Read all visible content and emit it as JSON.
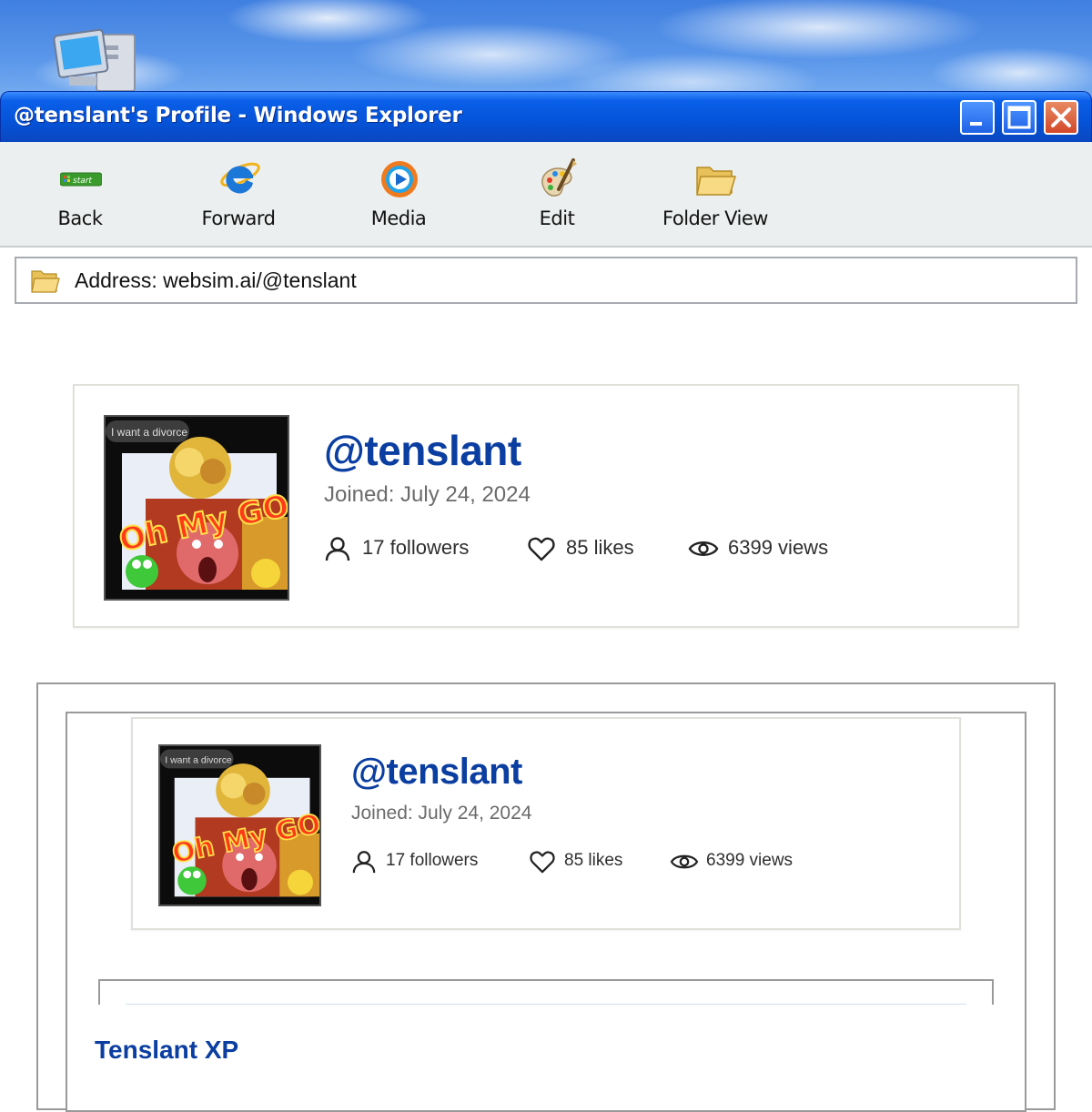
{
  "window": {
    "title": "@tenslant's Profile - Windows Explorer",
    "controls": {
      "minimize": "minimize",
      "maximize": "maximize",
      "close": "close"
    }
  },
  "toolbar": {
    "items": [
      {
        "label": "Back",
        "icon": "start-button-icon"
      },
      {
        "label": "Forward",
        "icon": "internet-explorer-icon"
      },
      {
        "label": "Media",
        "icon": "media-player-icon"
      },
      {
        "label": "Edit",
        "icon": "paint-palette-icon"
      },
      {
        "label": "Folder View",
        "icon": "folder-icon"
      }
    ],
    "start_badge": "start"
  },
  "address": {
    "text": "Address: websim.ai/@tenslant",
    "icon": "folder-icon"
  },
  "profile": {
    "username": "@tenslant",
    "joined": "Joined: July 24, 2024",
    "followers": "17 followers",
    "likes": "85 likes",
    "views": "6399 views",
    "avatar": {
      "caption": "I want a divorce",
      "overlay": "Oh My GOD!"
    }
  },
  "embedded": {
    "profile": {
      "username": "@tenslant",
      "joined": "Joined: July 24, 2024",
      "followers": "17 followers",
      "likes": "85 likes",
      "views": "6399 views",
      "avatar": {
        "caption": "I want a divorce",
        "overlay": "Oh My GOD!"
      }
    }
  },
  "section": {
    "title": "Tenslant XP"
  },
  "colors": {
    "titlebar": "#0553d8",
    "link_blue": "#0b3ea1",
    "toolbar_bg": "#ecefef"
  }
}
